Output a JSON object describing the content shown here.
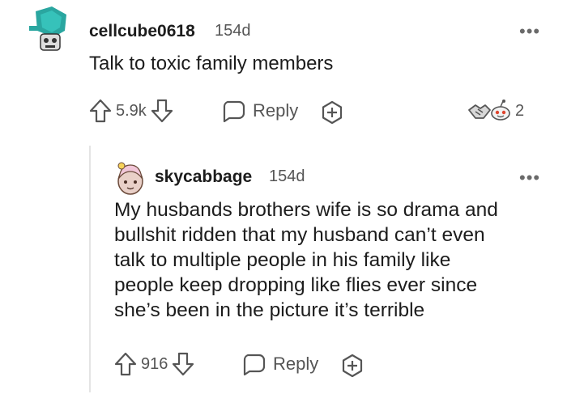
{
  "comment": {
    "username": "cellcube0618",
    "age": "154d",
    "body": "Talk to toxic family members",
    "votes": "5.9k",
    "reply_label": "Reply",
    "award_count": "2"
  },
  "reply": {
    "username": "skycabbage",
    "age": "154d",
    "body_lines": [
      "My husbands brothers wife is so drama and",
      "bullshit ridden that my husband can’t even",
      "talk to multiple people in his family like",
      "people keep dropping like flies ever since",
      "she’s been in the picture it’s terrible"
    ],
    "votes": "916",
    "reply_label": "Reply"
  },
  "more_glyph": "•••",
  "colors": {
    "text": "#1c1c1c",
    "meta": "#555555",
    "icon": "#555555",
    "thread_line": "#e4e4e4"
  },
  "icons": [
    "upvote-icon",
    "downvote-icon",
    "comment-bubble-icon",
    "award-add-icon",
    "award-handshake-icon",
    "award-snoo-icon"
  ]
}
